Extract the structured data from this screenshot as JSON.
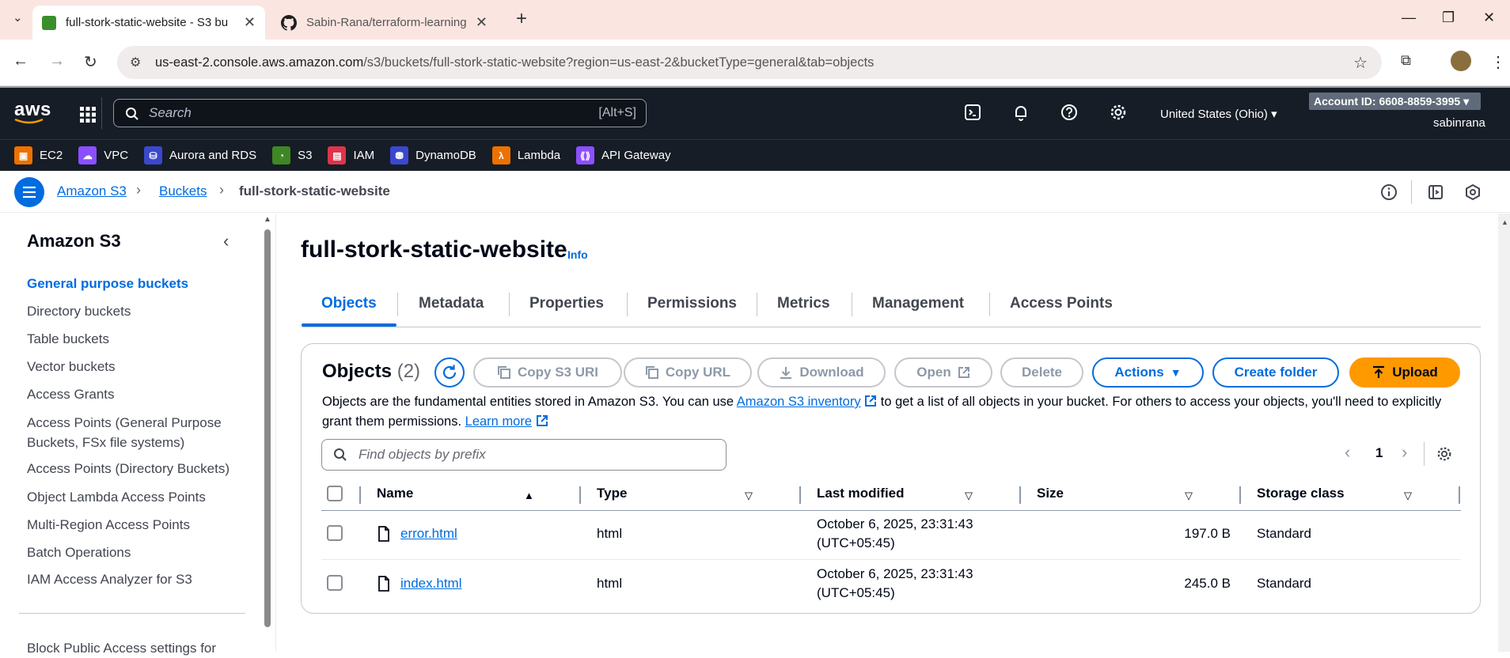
{
  "browser": {
    "tabs": [
      {
        "title": "full-stork-static-website - S3 bu",
        "active": true
      },
      {
        "title": "Sabin-Rana/terraform-learning",
        "active": false
      }
    ],
    "new_tab": "+",
    "url_domain": "us-east-2.console.aws.amazon.com",
    "url_path": "/s3/buckets/full-stork-static-website?region=us-east-2&bucketType=general&tab=objects"
  },
  "aws": {
    "logo": "aws",
    "search_placeholder": "Search",
    "search_shortcut": "[Alt+S]",
    "region": "United States (Ohio)",
    "account": "Account ID: 6608-8859-3995",
    "user": "sabinrana",
    "favorites": [
      {
        "label": "EC2",
        "color": "#ed7100"
      },
      {
        "label": "VPC",
        "color": "#8c4fff"
      },
      {
        "label": "Aurora and RDS",
        "color": "#3b48cc"
      },
      {
        "label": "S3",
        "color": "#3f8624"
      },
      {
        "label": "IAM",
        "color": "#dd344c"
      },
      {
        "label": "DynamoDB",
        "color": "#3b48cc"
      },
      {
        "label": "Lambda",
        "color": "#ed7100"
      },
      {
        "label": "API Gateway",
        "color": "#8c4fff"
      }
    ]
  },
  "breadcrumb": {
    "items": [
      "Amazon S3",
      "Buckets",
      "full-stork-static-website"
    ]
  },
  "sidebar": {
    "title": "Amazon S3",
    "items": [
      "General purpose buckets",
      "Directory buckets",
      "Table buckets",
      "Vector buckets",
      "Access Grants",
      "Access Points (General Purpose Buckets, FSx file systems)",
      "Access Points (Directory Buckets)",
      "Object Lambda Access Points",
      "Multi-Region Access Points",
      "Batch Operations",
      "IAM Access Analyzer for S3",
      "Block Public Access settings for"
    ]
  },
  "page": {
    "title": "full-stork-static-website",
    "info": "Info",
    "tabs": [
      "Objects",
      "Metadata",
      "Properties",
      "Permissions",
      "Metrics",
      "Management",
      "Access Points"
    ]
  },
  "objects": {
    "title": "Objects",
    "count": "(2)",
    "buttons": {
      "copy_uri": "Copy S3 URI",
      "copy_url": "Copy URL",
      "download": "Download",
      "open": "Open",
      "delete": "Delete",
      "actions": "Actions",
      "create_folder": "Create folder",
      "upload": "Upload"
    },
    "desc_1": "Objects are the fundamental entities stored in Amazon S3. You can use ",
    "desc_link": "Amazon S3 inventory",
    "desc_2": " to get a list of all objects in your bucket. For others to access your objects, you'll need to explicitly grant them permissions. ",
    "learn_more": "Learn more",
    "filter_placeholder": "Find objects by prefix",
    "page_number": "1",
    "columns": [
      "Name",
      "Type",
      "Last modified",
      "Size",
      "Storage class"
    ],
    "rows": [
      {
        "name": "error.html",
        "type": "html",
        "modified_1": "October 6, 2025, 23:31:43",
        "modified_2": "(UTC+05:45)",
        "size": "197.0 B",
        "storage": "Standard"
      },
      {
        "name": "index.html",
        "type": "html",
        "modified_1": "October 6, 2025, 23:31:43",
        "modified_2": "(UTC+05:45)",
        "size": "245.0 B",
        "storage": "Standard"
      }
    ]
  }
}
